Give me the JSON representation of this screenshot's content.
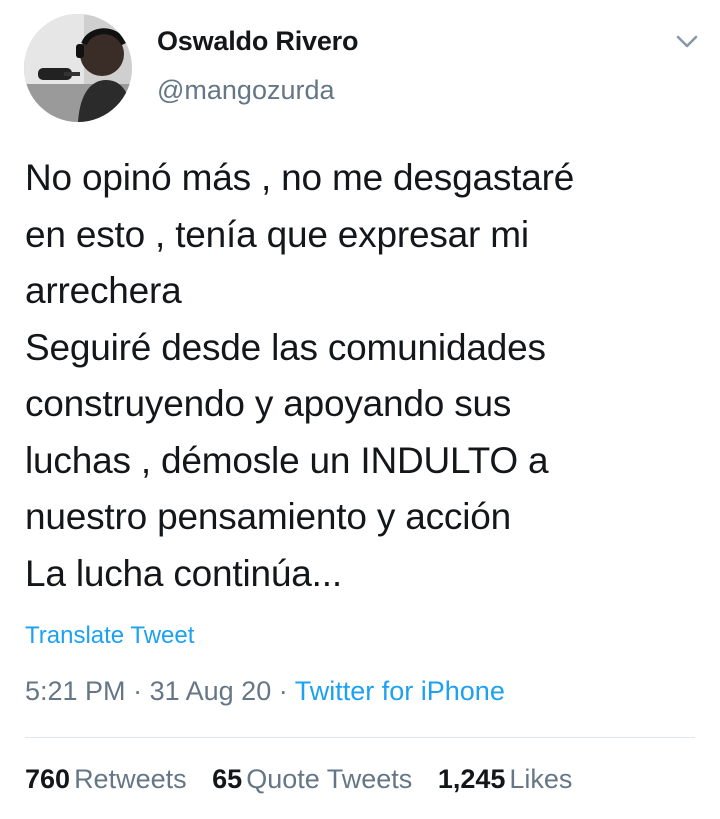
{
  "author": {
    "display_name": "Oswaldo Rivero",
    "handle": "@mangozurda",
    "avatar_icon": "profile-photo"
  },
  "menu_icon": "chevron-down-icon",
  "tweet": {
    "lines": [
      "No opinó más , no me desgastaré",
      "en esto , tenía que expresar mi",
      "arrechera",
      "Seguiré desde las comunidades",
      "construyendo y apoyando sus",
      "luchas , démosle un INDULTO a",
      "nuestro pensamiento y acción",
      "La lucha continúa..."
    ],
    "translate_label": "Translate Tweet",
    "time": "5:21 PM",
    "date": "31 Aug 20",
    "separator": "·",
    "source": "Twitter for iPhone"
  },
  "stats": {
    "retweets": {
      "count": "760",
      "label": "Retweets"
    },
    "quote_tweets": {
      "count": "65",
      "label": "Quote Tweets"
    },
    "likes": {
      "count": "1,245",
      "label": "Likes"
    }
  },
  "colors": {
    "accent": "#1da1f2",
    "text": "#14171a",
    "muted": "#657786",
    "divider": "#e1e8ed"
  }
}
